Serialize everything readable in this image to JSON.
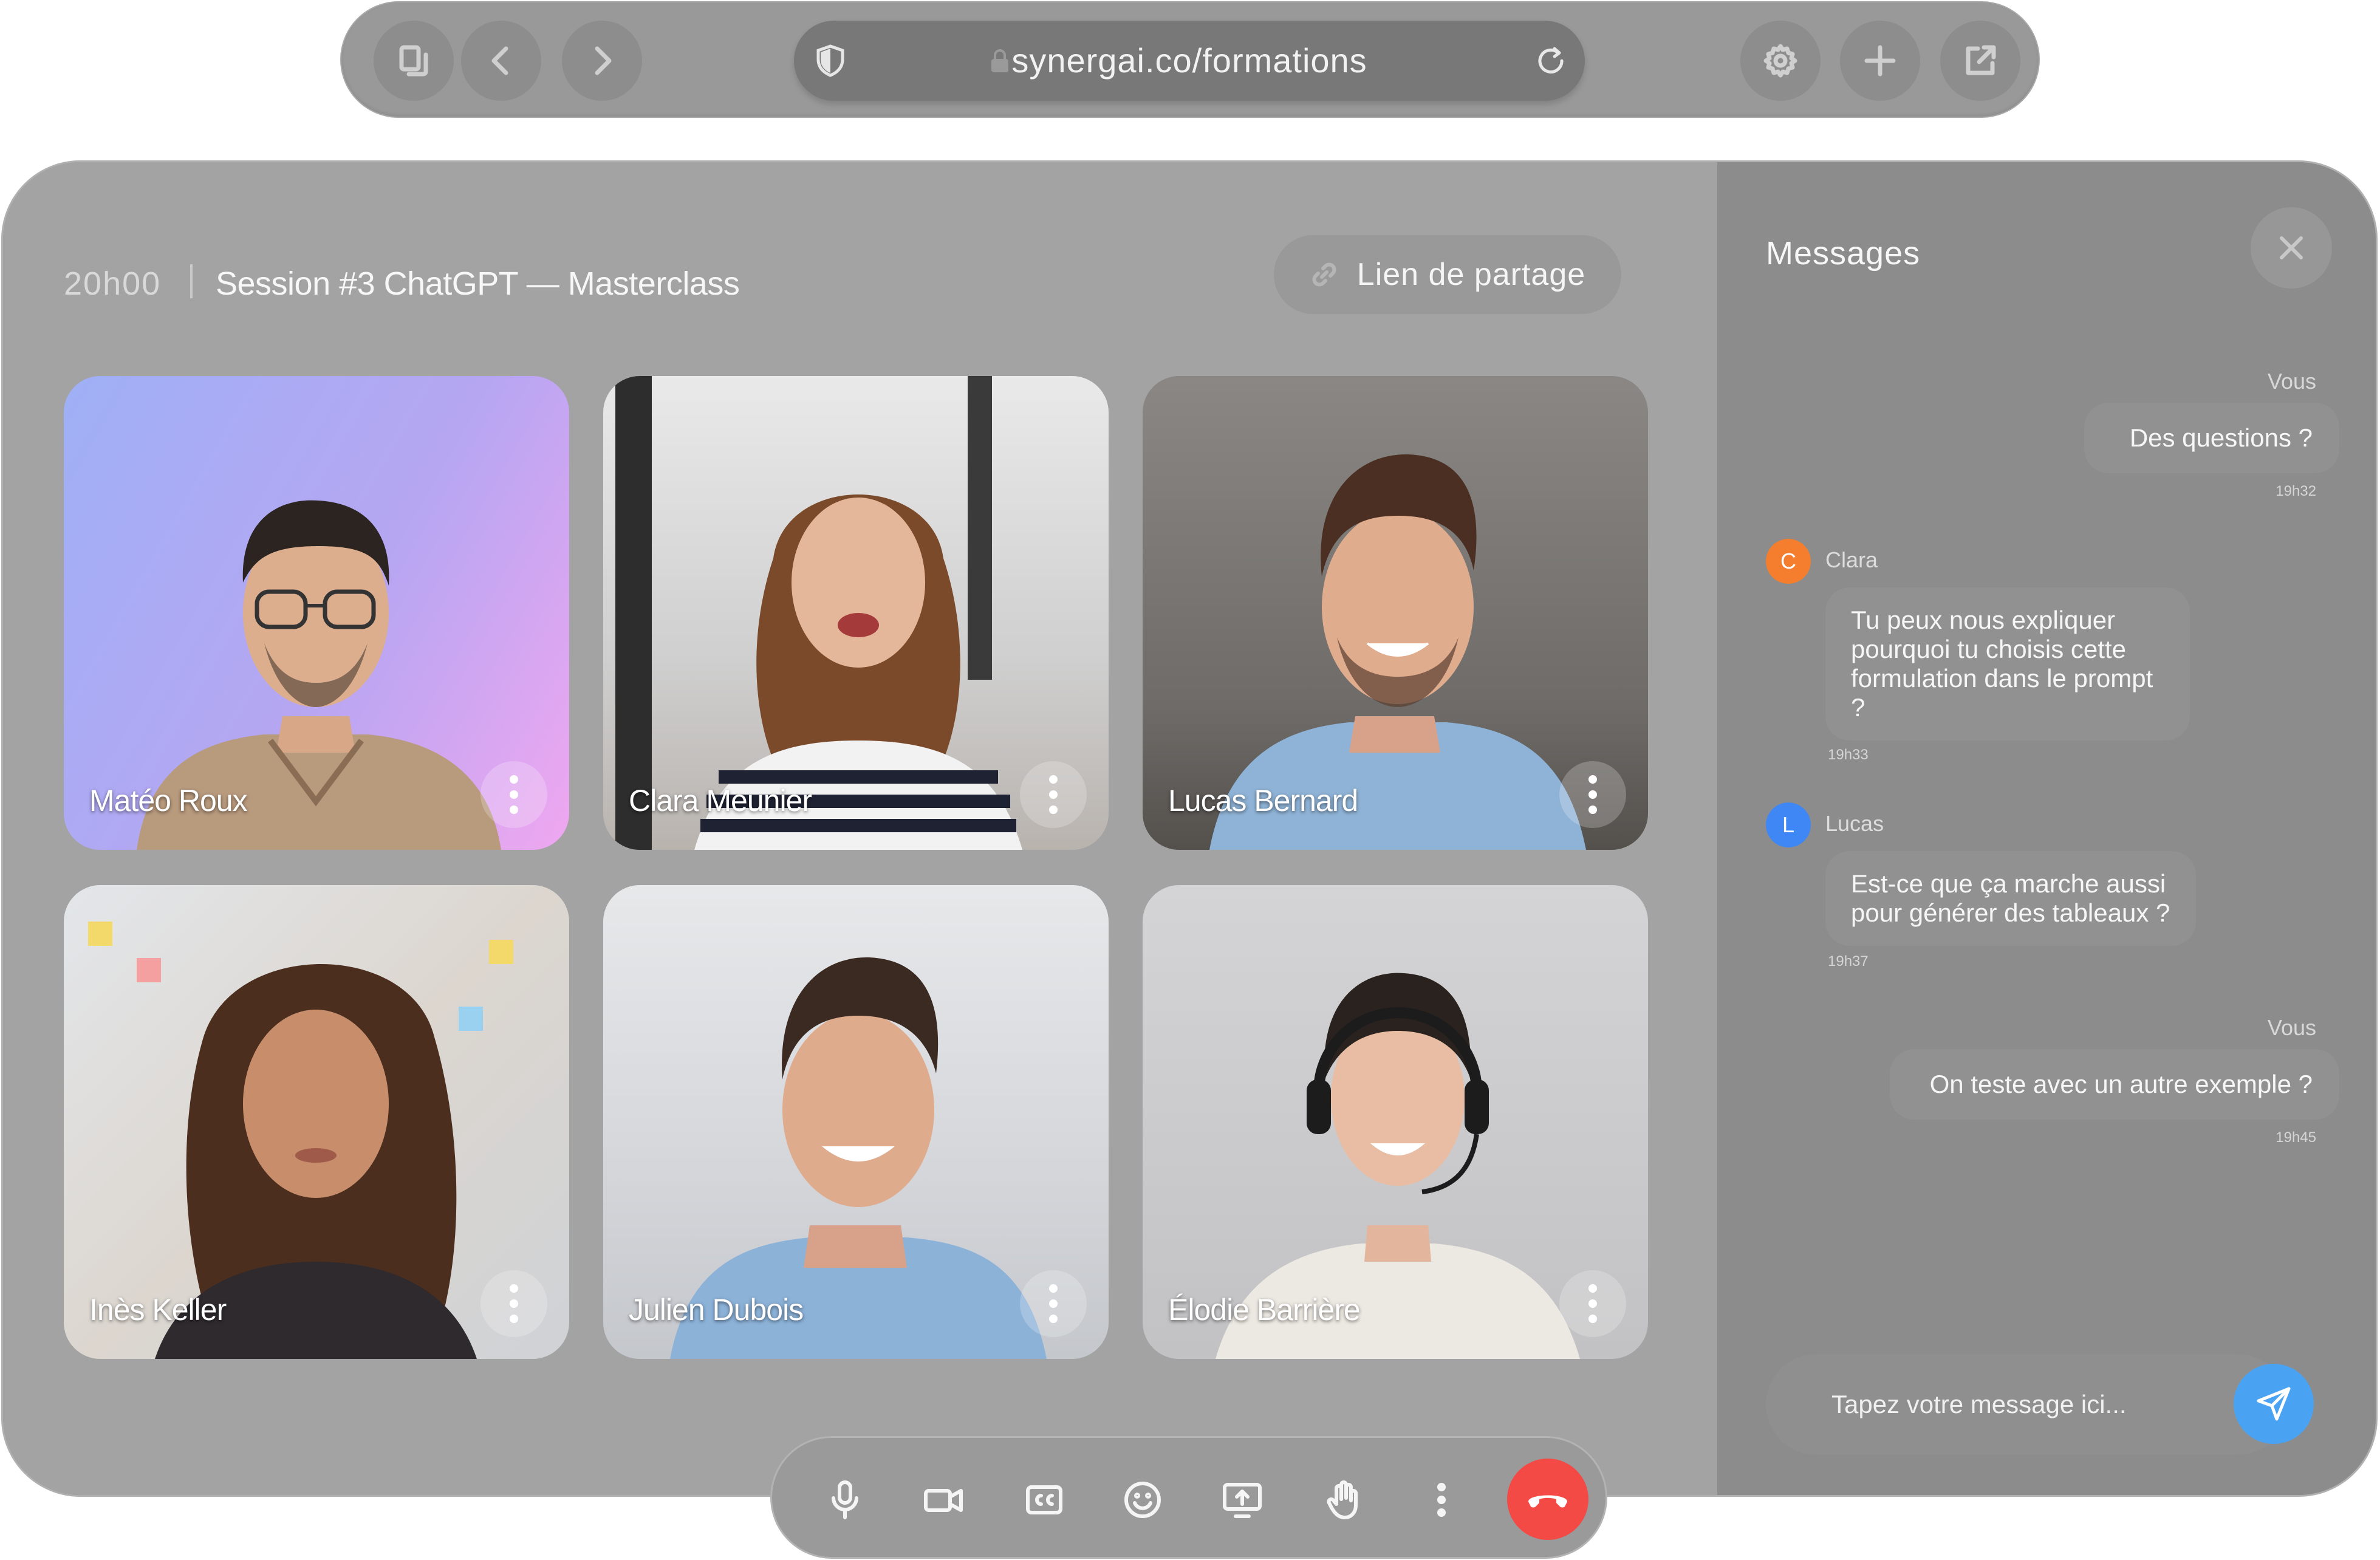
{
  "browser": {
    "url": "synergai.co/formations",
    "icons": [
      "tabs-icon",
      "back-icon",
      "forward-icon",
      "shield-icon",
      "lock-icon",
      "reload-icon",
      "settings-icon",
      "new-tab-icon",
      "share-out-icon"
    ]
  },
  "header": {
    "time": "20h00",
    "title": "Session #3 ChatGPT — Masterclass",
    "share_label": "Lien de partage"
  },
  "participants": [
    {
      "name": "Matéo Roux",
      "bg": "gradient-purple"
    },
    {
      "name": "Clara Meunier",
      "bg": "office"
    },
    {
      "name": "Lucas Bernard",
      "bg": "office-dark"
    },
    {
      "name": "Inès Keller",
      "bg": "board"
    },
    {
      "name": "Julien Dubois",
      "bg": "light"
    },
    {
      "name": "Élodie Barrière",
      "bg": "grey"
    }
  ],
  "controls": [
    "microphone-icon",
    "camera-icon",
    "captions-icon",
    "emoji-icon",
    "screen-share-icon",
    "raise-hand-icon",
    "more-icon",
    "end-call-icon"
  ],
  "chat": {
    "title": "Messages",
    "messages": [
      {
        "sender": "Vous",
        "text": "Des questions ?",
        "time": "19h32"
      },
      {
        "sender": "Clara",
        "initial": "C",
        "color": "#f47e2d",
        "text": "Tu peux nous expliquer pourquoi tu choisis cette formulation dans le prompt ?",
        "time": "19h33"
      },
      {
        "sender": "Lucas",
        "initial": "L",
        "color": "#3f87f5",
        "text": "Est-ce que ça marche aussi pour générer des tableaux ?",
        "time": "19h37"
      },
      {
        "sender": "Vous",
        "text": "On teste avec un autre exemple ?",
        "time": "19h45"
      }
    ],
    "input_placeholder": "Tapez votre message ici..."
  },
  "colors": {
    "accent": "#4aa3f2",
    "end_call": "#f34a45"
  }
}
